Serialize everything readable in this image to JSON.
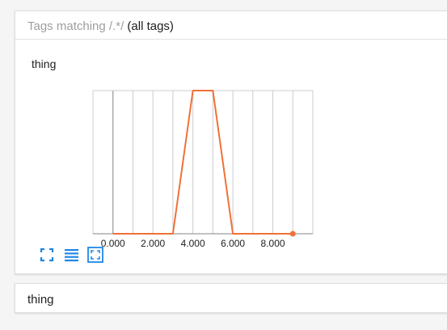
{
  "header": {
    "prefix": "Tags matching",
    "pattern": "/.*/",
    "suffix": "(all tags)"
  },
  "chart_panel": {
    "title": "thing",
    "toolbar": [
      {
        "icon": "expand-icon"
      },
      {
        "icon": "list-icon"
      },
      {
        "icon": "fit-domain-icon"
      }
    ]
  },
  "colors": {
    "series": "#f07138",
    "grid": "#cccccc",
    "axis": "#9e9e9e",
    "icon": "#1e88e5"
  },
  "chart_data": {
    "type": "line",
    "title": "thing",
    "xlabel": "",
    "ylabel": "",
    "xlim": [
      -1.0,
      10.0
    ],
    "xticks": [
      0,
      2,
      4,
      6,
      8
    ],
    "xtick_labels": [
      "0.000",
      "2.000",
      "4.000",
      "6.000",
      "8.000"
    ],
    "ylim": [
      0,
      1
    ],
    "grid": true,
    "series": [
      {
        "x": [
          0,
          1,
          2,
          3,
          4,
          5,
          6,
          7,
          8,
          9
        ],
        "y": [
          0,
          0,
          0,
          0,
          1,
          1,
          0,
          0,
          0,
          0
        ]
      }
    ]
  },
  "bottom": {
    "title": "thing"
  }
}
